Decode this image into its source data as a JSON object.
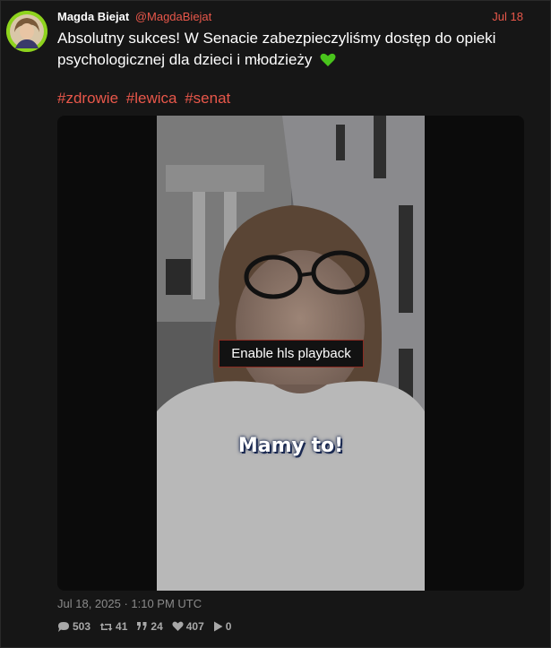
{
  "author": {
    "name": "Magda Biejat",
    "handle": "@MagdaBiejat",
    "date": "Jul 18",
    "avatar_color": "#8ed31d"
  },
  "tweet": {
    "text": "Absolutny sukces! W Senacie zabezpieczyliśmy dostęp do opieki psychologicznej dla dzieci i młodzieży",
    "emoji": "green-heart-icon",
    "hashtags": [
      "#zdrowie",
      "#lewica",
      "#senat"
    ],
    "timestamp": "Jul 18, 2025 · 1:10 PM UTC"
  },
  "media": {
    "overlay_caption": "Mamy to!",
    "hls_button_label": "Enable hls playback"
  },
  "stats": {
    "replies": "503",
    "retweets": "41",
    "quotes": "24",
    "likes": "407",
    "views": "0"
  },
  "icons": {
    "replies": "comment-icon",
    "retweets": "retweet-icon",
    "quotes": "quote-icon",
    "likes": "heart-icon",
    "views": "play-icon"
  },
  "colors": {
    "accent": "#e8574a",
    "background": "#161616",
    "text": "#ffffff",
    "muted": "#8a8a8a"
  }
}
